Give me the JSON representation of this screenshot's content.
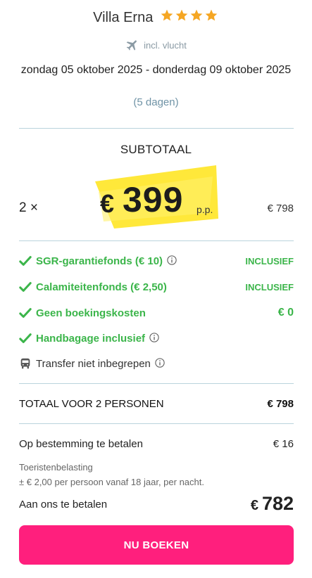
{
  "header": {
    "hotel_name": "Villa Erna",
    "stars": 4,
    "flight_label": "incl. vlucht",
    "dates": "zondag 05 oktober 2025 - donderdag 09 oktober 2025",
    "duration": "(5 dagen)"
  },
  "subtotal": {
    "heading": "SUBTOTAAL",
    "quantity": "2 ×",
    "currency": "€",
    "price": "399",
    "per_person": "p.p.",
    "line_total": "€ 798"
  },
  "inclusions": [
    {
      "label": "SGR-garantiefonds  (€ 10)",
      "value": "INCLUSIEF",
      "info": true
    },
    {
      "label": "Calamiteitenfonds  (€ 2,50)",
      "value": "INCLUSIEF",
      "info": false
    },
    {
      "label": "Geen boekingskosten",
      "value": "€ 0",
      "info": false
    },
    {
      "label": "Handbagage inclusief",
      "value": "",
      "info": true
    }
  ],
  "transfer": {
    "label": "Transfer niet inbegrepen"
  },
  "total": {
    "label": "TOTAAL VOOR 2 PERSONEN",
    "value": "€ 798"
  },
  "destination": {
    "label": "Op bestemming te betalen",
    "value": "€ 16",
    "tax_title": "Toeristenbelasting",
    "tax_detail": "± € 2,00 per persoon vanaf 18 jaar, per nacht."
  },
  "pay": {
    "label": "Aan ons te betalen",
    "currency": "€",
    "value": "782"
  },
  "book_button": "NU BOEKEN",
  "colors": {
    "accent": "#ff1f7d",
    "check": "#3bb54a",
    "star": "#f5a623",
    "highlight": "#ffe83a"
  }
}
